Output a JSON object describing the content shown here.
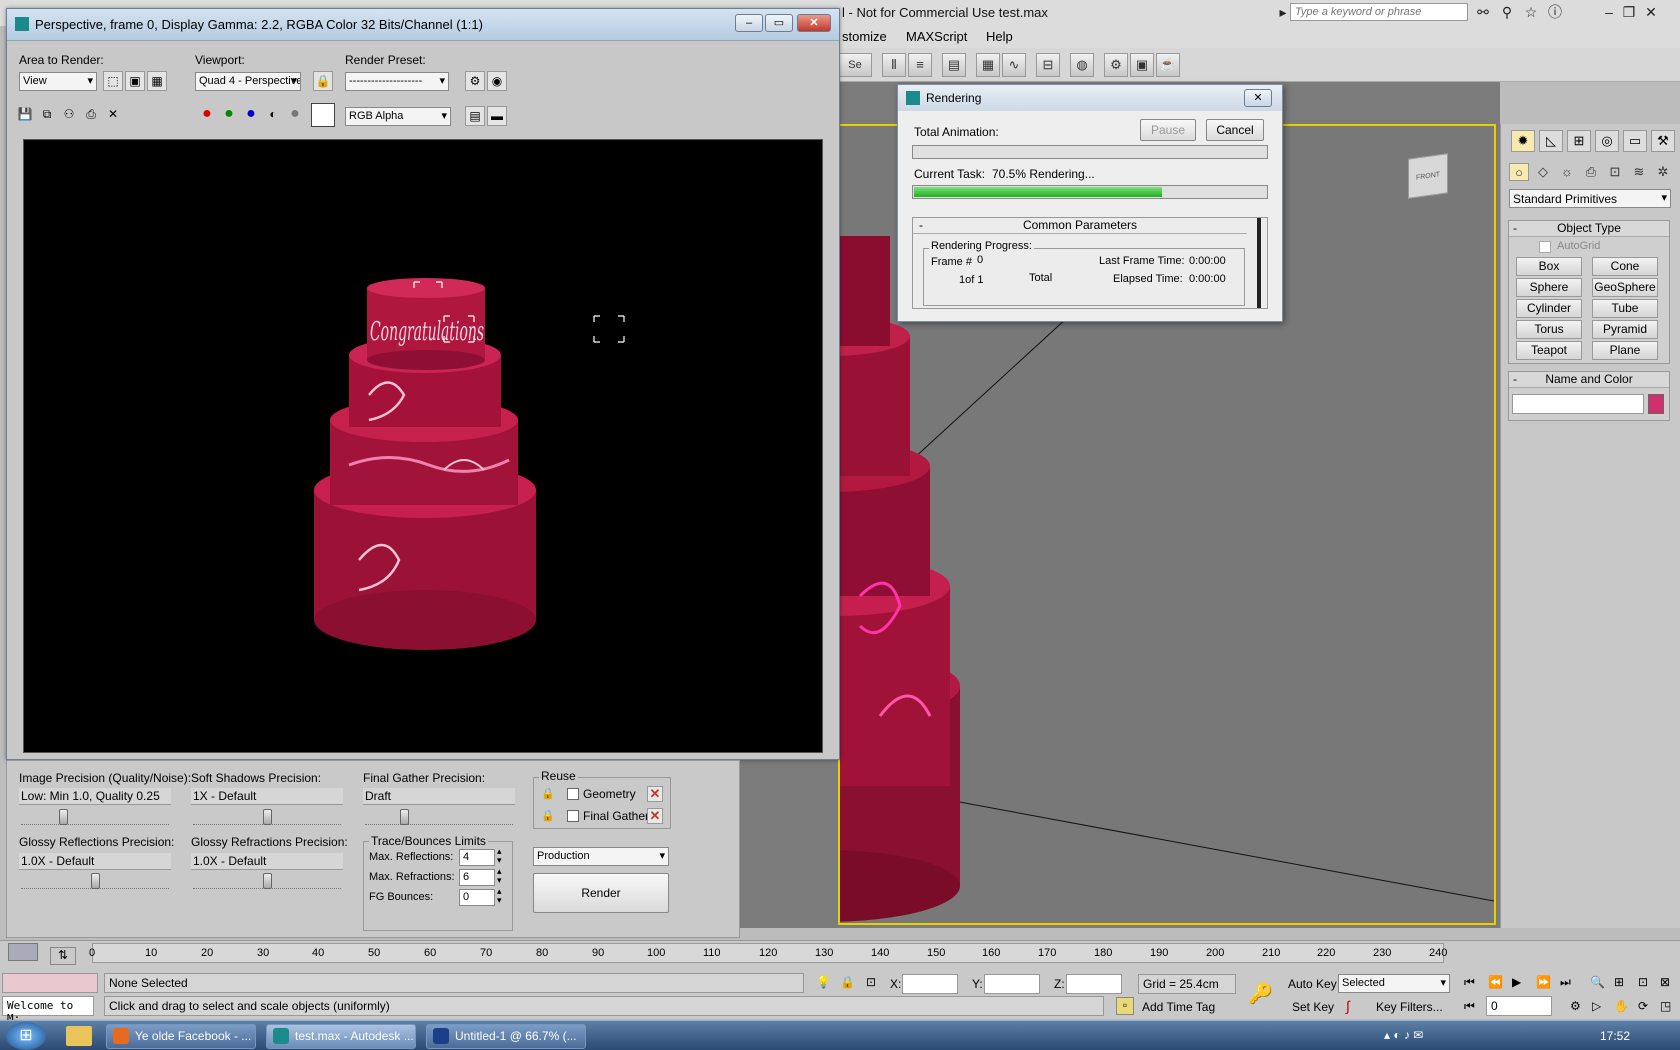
{
  "main_window": {
    "title": "l - Not for Commercial Use   test.max",
    "search_placeholder": "Type a keyword or phrase",
    "menu": [
      "stomize",
      "MAXScript",
      "Help"
    ],
    "toolbar_select": "Se"
  },
  "viewport": {
    "cube_label": "FRONT"
  },
  "command_panel": {
    "category": "Standard Primitives",
    "object_type_header": "Object Type",
    "autogrid_label": "AutoGrid",
    "primitives": [
      "Box",
      "Cone",
      "Sphere",
      "GeoSphere",
      "Cylinder",
      "Tube",
      "Torus",
      "Pyramid",
      "Teapot",
      "Plane"
    ],
    "name_color_header": "Name and Color",
    "name_value": "",
    "swatch_color": "#d0306c"
  },
  "frame_buffer": {
    "title": "Perspective, frame 0, Display Gamma: 2.2, RGBA Color 32 Bits/Channel (1:1)",
    "area_label": "Area to Render:",
    "area_value": "View",
    "viewport_label": "Viewport:",
    "viewport_value": "Quad 4 - Perspective",
    "preset_label": "Render Preset:",
    "preset_value": "--------------------",
    "channel_value": "RGB Alpha",
    "cake_text": "Congratulations"
  },
  "render_settings": {
    "image_precision_label": "Image Precision (Quality/Noise):",
    "image_precision_value": "Low: Min 1.0, Quality 0.25",
    "image_precision_level": 0.27,
    "soft_shadows_label": "Soft Shadows Precision:",
    "soft_shadows_value": "1X - Default",
    "soft_shadows_level": 0.5,
    "final_gather_label": "Final Gather Precision:",
    "final_gather_value": "Draft",
    "final_gather_level": 0.25,
    "glossy_reflections_label": "Glossy Reflections Precision:",
    "glossy_reflections_value": "1.0X - Default",
    "glossy_reflections_level": 0.5,
    "glossy_refractions_label": "Glossy Refractions Precision:",
    "glossy_refractions_value": "1.0X - Default",
    "glossy_refractions_level": 0.5,
    "reuse_label": "Reuse",
    "geometry_label": "Geometry",
    "final_gather_check_label": "Final Gather",
    "trace_label": "Trace/Bounces Limits",
    "max_reflections_label": "Max. Reflections:",
    "max_reflections_value": "4",
    "max_refractions_label": "Max. Refractions:",
    "max_refractions_value": "6",
    "fg_bounces_label": "FG Bounces:",
    "fg_bounces_value": "0",
    "mode_value": "Production",
    "render_button": "Render"
  },
  "rendering_dialog": {
    "title": "Rendering",
    "total_animation_label": "Total Animation:",
    "pause_button": "Pause",
    "cancel_button": "Cancel",
    "current_task_label": "Current Task:",
    "current_task_value": "70.5%  Rendering...",
    "current_progress": 0.705,
    "total_progress": 0.0,
    "common_params_header": "Common Parameters",
    "rendering_progress_label": "Rendering Progress:",
    "frame_label": "Frame #",
    "frame_value": "0",
    "of_label": "1of 1",
    "total_label": "Total",
    "last_frame_label": "Last Frame Time:",
    "last_frame_value": "0:00:00",
    "elapsed_label": "Elapsed Time:",
    "elapsed_value": "0:00:00"
  },
  "timeline": {
    "ticks": [
      "0",
      "10",
      "20",
      "30",
      "40",
      "50",
      "60",
      "70",
      "80",
      "90",
      "100",
      "110",
      "120",
      "130",
      "140",
      "150",
      "160",
      "170",
      "180",
      "190",
      "200",
      "210",
      "220",
      "230",
      "240"
    ]
  },
  "status": {
    "welcome": "Welcome to M:",
    "selection": "None Selected",
    "prompt": "Click and drag to select and scale objects (uniformly)",
    "x_label": "X:",
    "y_label": "Y:",
    "z_label": "Z:",
    "grid": "Grid = 25.4cm",
    "add_time_tag": "Add Time Tag",
    "auto_key": "Auto Key",
    "set_key": "Set Key",
    "selected": "Selected",
    "key_filters": "Key Filters...",
    "frame_field": "0"
  },
  "taskbar": {
    "items": [
      "Ye olde Facebook - ...",
      "test.max - Autodesk ...",
      "Untitled-1 @ 66.7% (..."
    ],
    "clock": "17:52"
  }
}
